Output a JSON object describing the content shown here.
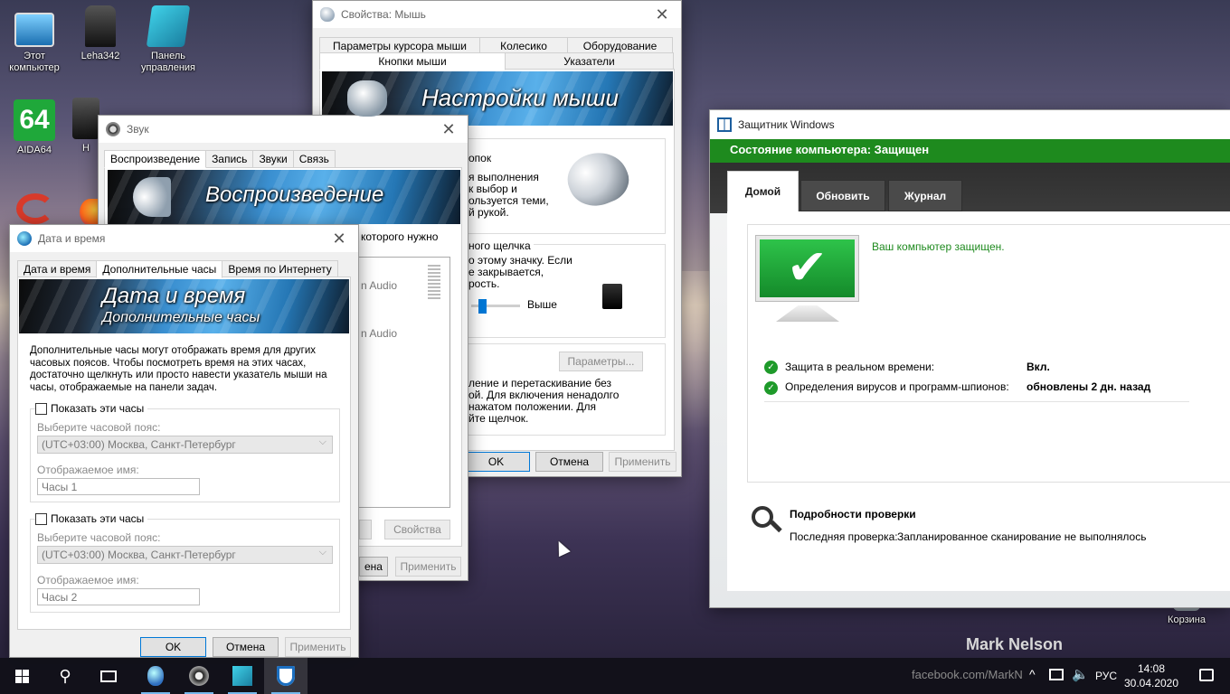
{
  "desktop": {
    "icons": [
      {
        "label": "Этот компьютер"
      },
      {
        "label": "Leha342"
      },
      {
        "label": "Панель управления"
      },
      {
        "label": "AIDA64"
      },
      {
        "label": "H"
      },
      {
        "label": "Корзина"
      }
    ],
    "aida_badge": "64",
    "watermark_name": "Mark Nelson",
    "watermark_url": "facebook.com/MarkN"
  },
  "mouse": {
    "title": "Свойства: Мышь",
    "tabs_row1": [
      "Параметры курсора мыши",
      "Колесико",
      "Оборудование"
    ],
    "tabs_row2": [
      "Кнопки мыши",
      "Указатели"
    ],
    "banner": "Настройки мыши",
    "buttons_text": [
      "опок",
      "я выполнения",
      "к выбор и",
      "ользуется теми,",
      "й рукой."
    ],
    "dblclick_heading": "ного щелчка",
    "dblclick_text": [
      "о этому значку. Если",
      "е закрывается,",
      "рость."
    ],
    "speed_high": "Выше",
    "params_button": "Параметры...",
    "clicklock_text": [
      "ление и перетаскивание без",
      "ой. Для включения ненадолго",
      "нажатом положении. Для",
      "йте щелчок."
    ],
    "ok": "OK",
    "cancel": "Отмена",
    "apply": "Применить"
  },
  "sound": {
    "title": "Звук",
    "tabs": [
      "Воспроизведение",
      "Запись",
      "Звуки",
      "Связь"
    ],
    "banner": "Воспроизведение",
    "hint": "которого нужно",
    "devices": [
      "n Audio",
      "n Audio"
    ],
    "properties": "Свойства",
    "cancel_partial": "ена",
    "apply": "Применить"
  },
  "datetime": {
    "title": "Дата и время",
    "tabs": [
      "Дата и время",
      "Дополнительные часы",
      "Время по Интернету"
    ],
    "banner_line1": "Дата и время",
    "banner_line2": "Дополнительные часы",
    "description": "Дополнительные часы могут отображать время для других часовых поясов. Чтобы посмотреть время на этих часах, достаточно щелкнуть или просто навести указатель мыши на часы, отображаемые на панели задач.",
    "clock1": {
      "show": "Показать эти часы",
      "tz_label": "Выберите часовой пояс:",
      "tz_value": "(UTC+03:00) Москва, Санкт-Петербург",
      "name_label": "Отображаемое имя:",
      "name_value": "Часы 1"
    },
    "clock2": {
      "show": "Показать эти часы",
      "tz_label": "Выберите часовой пояс:",
      "tz_value": "(UTC+03:00) Москва, Санкт-Петербург",
      "name_label": "Отображаемое имя:",
      "name_value": "Часы 2"
    },
    "ok": "OK",
    "cancel": "Отмена",
    "apply": "Применить"
  },
  "defender": {
    "title": "Защитник Windows",
    "status": "Состояние компьютера: Защищен",
    "tabs": [
      "Домой",
      "Обновить",
      "Журнал"
    ],
    "protected_msg": "Ваш компьютер защищен.",
    "rows": [
      {
        "label": "Защита в реальном времени:",
        "value": "Вкл."
      },
      {
        "label": "Определения вирусов и программ-шпионов:",
        "value": "обновлены 2 дн. назад"
      }
    ],
    "scan_heading": "Подробности проверки",
    "scan_label": "Последняя проверка:",
    "scan_value": "Запланированное сканирование не выполнялось",
    "accent": "#1e8a1e"
  },
  "taskbar": {
    "lang": "РУС",
    "time": "14:08",
    "date": "30.04.2020"
  }
}
